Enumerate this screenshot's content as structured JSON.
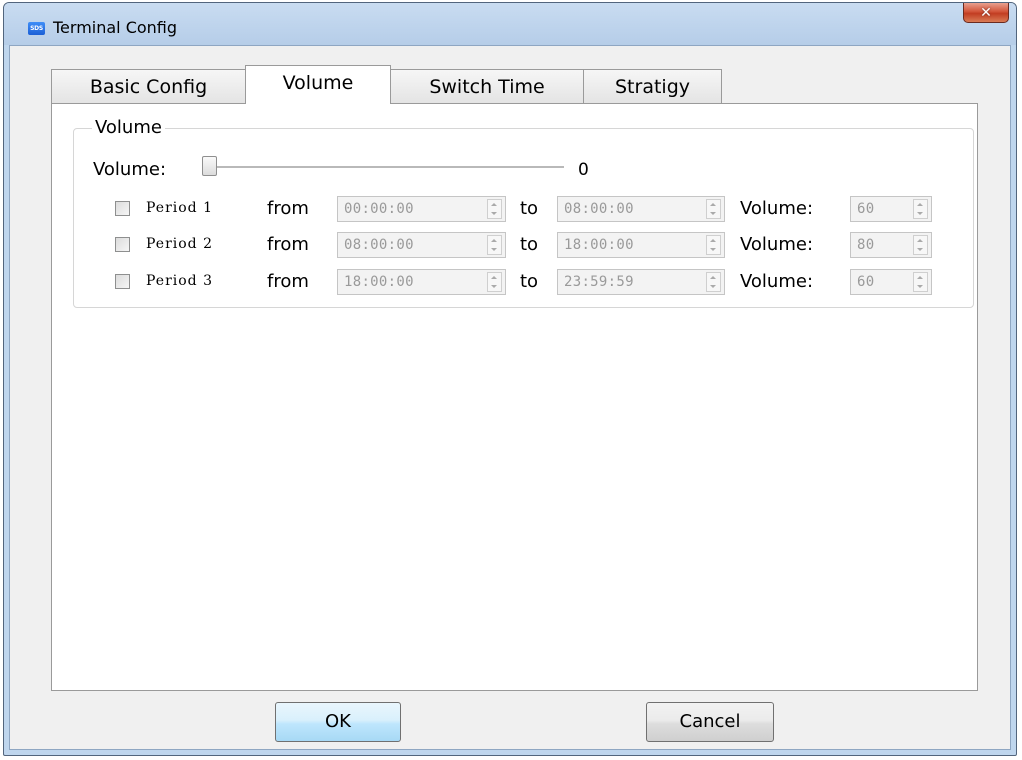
{
  "window": {
    "app_icon_text": "SDS",
    "title": "Terminal Config",
    "close_glyph": "✕"
  },
  "tabs": [
    {
      "label": "Basic Config",
      "selected": false
    },
    {
      "label": "Volume",
      "selected": true
    },
    {
      "label": "Switch Time",
      "selected": false
    },
    {
      "label": "Stratigy",
      "selected": false
    }
  ],
  "volume_group": {
    "title": "Volume",
    "slider_label": "Volume:",
    "slider_value": "0",
    "slider_level": 0
  },
  "periods": [
    {
      "label": "Period 1",
      "from_label": "from",
      "from": "00:00:00",
      "to_label": "to",
      "to": "08:00:00",
      "volume_label": "Volume:",
      "volume": "60",
      "checked": false
    },
    {
      "label": "Period 2",
      "from_label": "from",
      "from": "08:00:00",
      "to_label": "to",
      "to": "18:00:00",
      "volume_label": "Volume:",
      "volume": "80",
      "checked": false
    },
    {
      "label": "Period 3",
      "from_label": "from",
      "from": "18:00:00",
      "to_label": "to",
      "to": "23:59:59",
      "volume_label": "Volume:",
      "volume": "60",
      "checked": false
    }
  ],
  "buttons": {
    "ok_label": "OK",
    "cancel_label": "Cancel"
  },
  "icons": {
    "app": "app-icon",
    "close": "close-icon",
    "spin_up": "spin-up-icon",
    "spin_down": "spin-down-icon"
  },
  "colors": {
    "titlebar": "#bfd6ee",
    "close_button": "#c23d22",
    "ok_button": "#bee6fd",
    "disabled_text": "#9a9a9a"
  }
}
